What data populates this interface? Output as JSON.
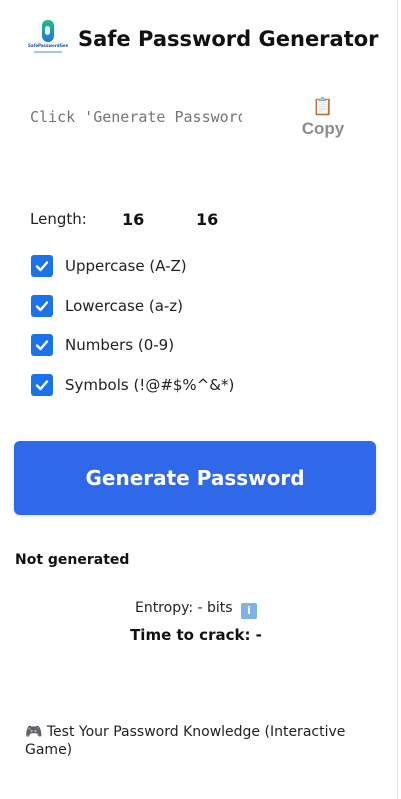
{
  "header": {
    "title": "Safe Password Generator",
    "logo_text": "SafePasswordGenerator",
    "logo_icon": "drop-logo-icon"
  },
  "password": {
    "placeholder": "Click 'Generate Password'",
    "value": ""
  },
  "copy": {
    "icon": "clipboard-icon",
    "label": "Copy"
  },
  "length": {
    "label": "Length:",
    "slider_value": "16",
    "display_value": "16"
  },
  "options": [
    {
      "label": "Uppercase (A-Z)",
      "checked": true
    },
    {
      "label": "Lowercase (a-z)",
      "checked": true
    },
    {
      "label": "Numbers (0-9)",
      "checked": true
    },
    {
      "label": "Symbols (!@#$%^&*)",
      "checked": true
    }
  ],
  "generate_button": {
    "label": "Generate Password",
    "color": "#2f68e8"
  },
  "strength": {
    "status": "Not generated"
  },
  "entropy": {
    "text": "Entropy: - bits",
    "info_icon": "info-icon"
  },
  "crack": {
    "text": "Time to crack: -"
  },
  "game_link": {
    "icon": "game-controller-icon",
    "label": "🎮 Test Your Password Knowledge (Interactive Game)"
  }
}
